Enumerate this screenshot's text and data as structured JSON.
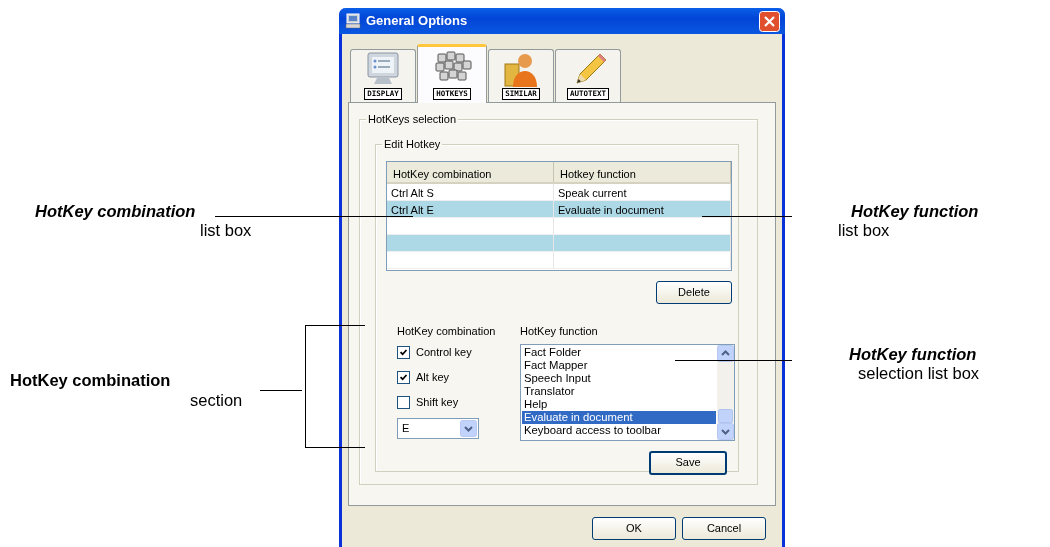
{
  "window": {
    "title": "General Options"
  },
  "tabs": [
    {
      "label": "DISPLAY",
      "selected": false,
      "kind": "monitor"
    },
    {
      "label": "HOTKEYS",
      "selected": true,
      "kind": "keyboard"
    },
    {
      "label": "SIMILAR",
      "selected": false,
      "kind": "person"
    },
    {
      "label": "AUTOTEXT",
      "selected": false,
      "kind": "pencil"
    }
  ],
  "hotkeys_group": {
    "title": "HotKeys selection"
  },
  "edit_group": {
    "title": "Edit Hotkey"
  },
  "table": {
    "columns": [
      "HotKey combination",
      "Hotkey function"
    ],
    "rows": [
      [
        "Ctrl Alt S",
        "Speak current"
      ],
      [
        "Ctrl Alt E",
        "Evaluate in document"
      ]
    ]
  },
  "delete_button": "Delete",
  "combination": {
    "label": "HotKey combination",
    "checkboxes": [
      {
        "label": "Control key",
        "checked": true
      },
      {
        "label": "Alt key",
        "checked": true
      },
      {
        "label": "Shift key",
        "checked": false
      }
    ],
    "key_select": {
      "value": "E"
    }
  },
  "function": {
    "label": "HotKey function",
    "items": [
      {
        "label": "Fact Folder",
        "selected": false
      },
      {
        "label": "Fact Mapper",
        "selected": false
      },
      {
        "label": "Speech Input",
        "selected": false
      },
      {
        "label": "Translator",
        "selected": false
      },
      {
        "label": "Help",
        "selected": false
      },
      {
        "label": "Evaluate in document",
        "selected": true
      },
      {
        "label": "Keyboard access to toolbar",
        "selected": false
      }
    ]
  },
  "save_button": "Save",
  "buttons": [
    "OK",
    "Cancel"
  ],
  "callouts": [
    {
      "title": "HotKey combination",
      "text": "list box",
      "italic": true
    },
    {
      "title": "HotKey function",
      "text": "list box",
      "italic": true
    },
    {
      "title": "HotKey combination",
      "text": "section",
      "italic": false
    },
    {
      "title": "HotKey function",
      "text": "selection list box",
      "italic": true
    }
  ]
}
